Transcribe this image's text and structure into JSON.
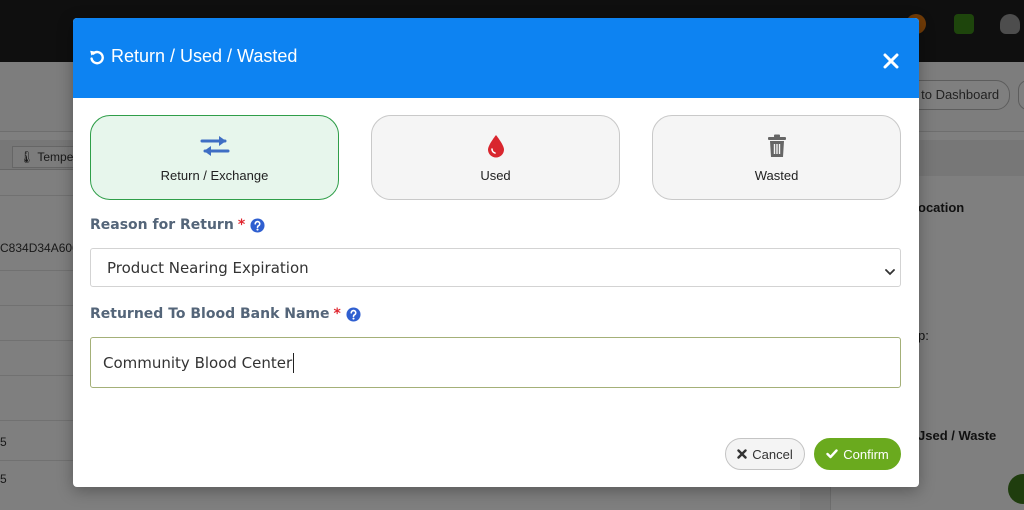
{
  "background": {
    "back_to_dashboard": "k to Dashboard",
    "tab_label": "Tempe",
    "id_fragment": "C834D34A606",
    "row_numbers": [
      "5",
      "5"
    ],
    "right_panel": {
      "location": "ocation",
      "field_suffix": "p:",
      "used_waste": "Jsed / Waste"
    }
  },
  "modal": {
    "title": "Return / Used / Wasted",
    "options": [
      {
        "label": "Return / Exchange",
        "icon": "exchange-arrows-icon",
        "selected": true
      },
      {
        "label": "Used",
        "icon": "blood-drop-icon",
        "selected": false
      },
      {
        "label": "Wasted",
        "icon": "trash-icon",
        "selected": false
      }
    ],
    "reason_label": "Reason for Return",
    "reason_value": "Product Nearing Expiration",
    "bank_label": "Returned To Blood Bank Name",
    "bank_value": "Community Blood Center",
    "required_mark": "*",
    "cancel_label": "Cancel",
    "confirm_label": "Confirm"
  },
  "colors": {
    "header_blue": "#0d83f2",
    "selected_green": "#2f9e49",
    "confirm_green": "#6aaa1e",
    "required_red": "#e0262f"
  }
}
